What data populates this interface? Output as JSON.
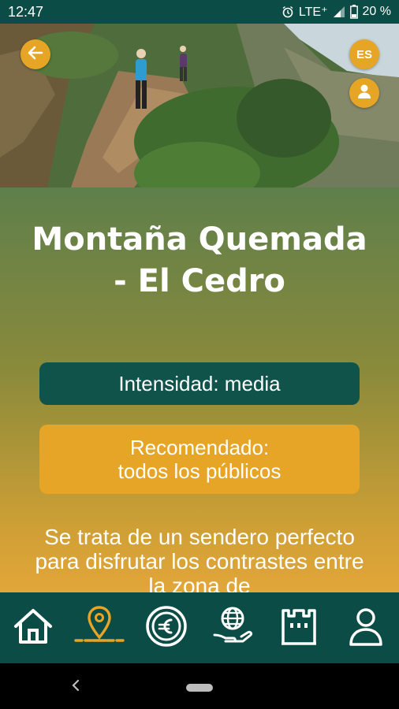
{
  "status": {
    "time": "12:47",
    "network": "LTE⁺",
    "battery": "20 %"
  },
  "hero": {
    "language_label": "ES"
  },
  "route": {
    "title": "Montaña Quemada - El Cedro",
    "intensity": "Intensidad: media",
    "recommended_line1": "Recomendado:",
    "recommended_line2": "todos los públicos",
    "description": "Se trata de un sendero perfecto para disfrutar los contrastes entre la zona de"
  },
  "bottom_nav": {
    "items": [
      {
        "icon": "home-icon"
      },
      {
        "icon": "map-pin-route-icon",
        "active": true
      },
      {
        "icon": "euro-icon"
      },
      {
        "icon": "globe-hand-icon"
      },
      {
        "icon": "castle-icon"
      },
      {
        "icon": "user-icon"
      }
    ]
  },
  "colors": {
    "dark_green": "#0b4d46",
    "accent_yellow": "#e6a526"
  }
}
